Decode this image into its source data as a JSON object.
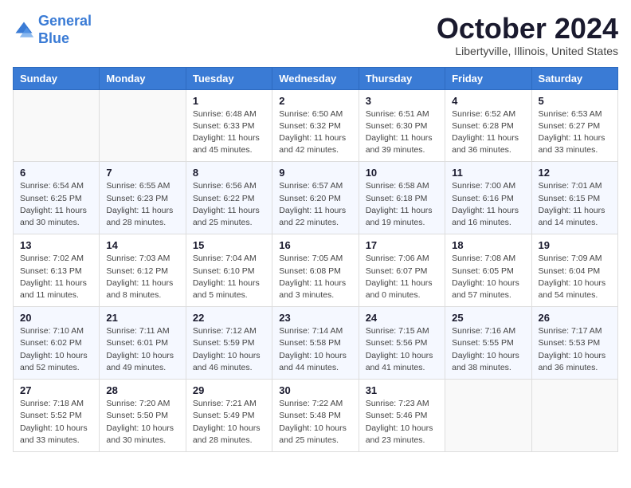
{
  "logo": {
    "line1": "General",
    "line2": "Blue"
  },
  "title": "October 2024",
  "location": "Libertyville, Illinois, United States",
  "weekdays": [
    "Sunday",
    "Monday",
    "Tuesday",
    "Wednesday",
    "Thursday",
    "Friday",
    "Saturday"
  ],
  "weeks": [
    [
      {
        "day": "",
        "info": ""
      },
      {
        "day": "",
        "info": ""
      },
      {
        "day": "1",
        "info": "Sunrise: 6:48 AM\nSunset: 6:33 PM\nDaylight: 11 hours and 45 minutes."
      },
      {
        "day": "2",
        "info": "Sunrise: 6:50 AM\nSunset: 6:32 PM\nDaylight: 11 hours and 42 minutes."
      },
      {
        "day": "3",
        "info": "Sunrise: 6:51 AM\nSunset: 6:30 PM\nDaylight: 11 hours and 39 minutes."
      },
      {
        "day": "4",
        "info": "Sunrise: 6:52 AM\nSunset: 6:28 PM\nDaylight: 11 hours and 36 minutes."
      },
      {
        "day": "5",
        "info": "Sunrise: 6:53 AM\nSunset: 6:27 PM\nDaylight: 11 hours and 33 minutes."
      }
    ],
    [
      {
        "day": "6",
        "info": "Sunrise: 6:54 AM\nSunset: 6:25 PM\nDaylight: 11 hours and 30 minutes."
      },
      {
        "day": "7",
        "info": "Sunrise: 6:55 AM\nSunset: 6:23 PM\nDaylight: 11 hours and 28 minutes."
      },
      {
        "day": "8",
        "info": "Sunrise: 6:56 AM\nSunset: 6:22 PM\nDaylight: 11 hours and 25 minutes."
      },
      {
        "day": "9",
        "info": "Sunrise: 6:57 AM\nSunset: 6:20 PM\nDaylight: 11 hours and 22 minutes."
      },
      {
        "day": "10",
        "info": "Sunrise: 6:58 AM\nSunset: 6:18 PM\nDaylight: 11 hours and 19 minutes."
      },
      {
        "day": "11",
        "info": "Sunrise: 7:00 AM\nSunset: 6:16 PM\nDaylight: 11 hours and 16 minutes."
      },
      {
        "day": "12",
        "info": "Sunrise: 7:01 AM\nSunset: 6:15 PM\nDaylight: 11 hours and 14 minutes."
      }
    ],
    [
      {
        "day": "13",
        "info": "Sunrise: 7:02 AM\nSunset: 6:13 PM\nDaylight: 11 hours and 11 minutes."
      },
      {
        "day": "14",
        "info": "Sunrise: 7:03 AM\nSunset: 6:12 PM\nDaylight: 11 hours and 8 minutes."
      },
      {
        "day": "15",
        "info": "Sunrise: 7:04 AM\nSunset: 6:10 PM\nDaylight: 11 hours and 5 minutes."
      },
      {
        "day": "16",
        "info": "Sunrise: 7:05 AM\nSunset: 6:08 PM\nDaylight: 11 hours and 3 minutes."
      },
      {
        "day": "17",
        "info": "Sunrise: 7:06 AM\nSunset: 6:07 PM\nDaylight: 11 hours and 0 minutes."
      },
      {
        "day": "18",
        "info": "Sunrise: 7:08 AM\nSunset: 6:05 PM\nDaylight: 10 hours and 57 minutes."
      },
      {
        "day": "19",
        "info": "Sunrise: 7:09 AM\nSunset: 6:04 PM\nDaylight: 10 hours and 54 minutes."
      }
    ],
    [
      {
        "day": "20",
        "info": "Sunrise: 7:10 AM\nSunset: 6:02 PM\nDaylight: 10 hours and 52 minutes."
      },
      {
        "day": "21",
        "info": "Sunrise: 7:11 AM\nSunset: 6:01 PM\nDaylight: 10 hours and 49 minutes."
      },
      {
        "day": "22",
        "info": "Sunrise: 7:12 AM\nSunset: 5:59 PM\nDaylight: 10 hours and 46 minutes."
      },
      {
        "day": "23",
        "info": "Sunrise: 7:14 AM\nSunset: 5:58 PM\nDaylight: 10 hours and 44 minutes."
      },
      {
        "day": "24",
        "info": "Sunrise: 7:15 AM\nSunset: 5:56 PM\nDaylight: 10 hours and 41 minutes."
      },
      {
        "day": "25",
        "info": "Sunrise: 7:16 AM\nSunset: 5:55 PM\nDaylight: 10 hours and 38 minutes."
      },
      {
        "day": "26",
        "info": "Sunrise: 7:17 AM\nSunset: 5:53 PM\nDaylight: 10 hours and 36 minutes."
      }
    ],
    [
      {
        "day": "27",
        "info": "Sunrise: 7:18 AM\nSunset: 5:52 PM\nDaylight: 10 hours and 33 minutes."
      },
      {
        "day": "28",
        "info": "Sunrise: 7:20 AM\nSunset: 5:50 PM\nDaylight: 10 hours and 30 minutes."
      },
      {
        "day": "29",
        "info": "Sunrise: 7:21 AM\nSunset: 5:49 PM\nDaylight: 10 hours and 28 minutes."
      },
      {
        "day": "30",
        "info": "Sunrise: 7:22 AM\nSunset: 5:48 PM\nDaylight: 10 hours and 25 minutes."
      },
      {
        "day": "31",
        "info": "Sunrise: 7:23 AM\nSunset: 5:46 PM\nDaylight: 10 hours and 23 minutes."
      },
      {
        "day": "",
        "info": ""
      },
      {
        "day": "",
        "info": ""
      }
    ]
  ]
}
